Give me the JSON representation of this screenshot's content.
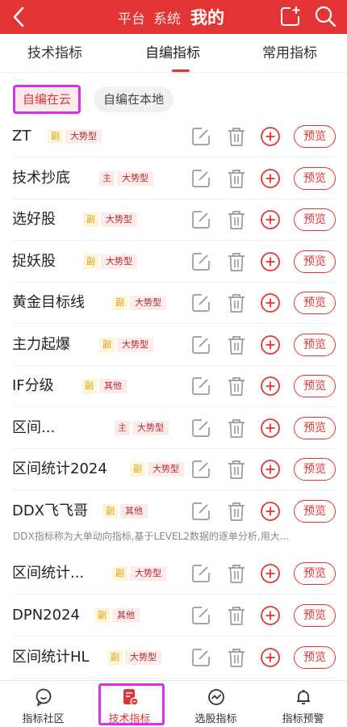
{
  "topbar": {
    "nav": [
      "平台",
      "系统",
      "我的"
    ],
    "active": "我的"
  },
  "tabs": [
    "技术指标",
    "自编指标",
    "常用指标"
  ],
  "filters": {
    "cloud": "自编在云",
    "local": "自编在本地"
  },
  "rows": [
    {
      "name": "ZT",
      "role": "副",
      "category": "大势型"
    },
    {
      "name": "技术抄底",
      "role": "主",
      "category": "大势型"
    },
    {
      "name": "选好股",
      "role": "副",
      "category": "大势型"
    },
    {
      "name": "捉妖股",
      "role": "副",
      "category": "大势型"
    },
    {
      "name": "黄金目标线",
      "role": "副",
      "category": "大势型"
    },
    {
      "name": "主力起爆",
      "role": "副",
      "category": "大势型"
    },
    {
      "name": "IF分级",
      "role": "副",
      "category": "其他"
    },
    {
      "name": "区间...",
      "role": "主",
      "category": "大势型"
    },
    {
      "name": "区间统计2024",
      "role": "副",
      "category": "大势型"
    },
    {
      "name": "DDX飞飞哥",
      "role": "副",
      "category": "其他"
    },
    {
      "name": "区间统计...",
      "role": "副",
      "category": "大势型"
    },
    {
      "name": "DPN2024",
      "role": "副",
      "category": "其他"
    },
    {
      "name": "区间统计HL",
      "role": "副",
      "category": "大势型"
    }
  ],
  "preview_label": "预览",
  "ddx_desc": "DDX指标称为大单动向指标,基于LEVEL2数据的逐单分析,用大...",
  "bottomnav": [
    "指标社区",
    "技术指标",
    "选股指标",
    "指标预警"
  ],
  "colors": {
    "accent": "#e23434",
    "highlight": "#d633e8"
  }
}
